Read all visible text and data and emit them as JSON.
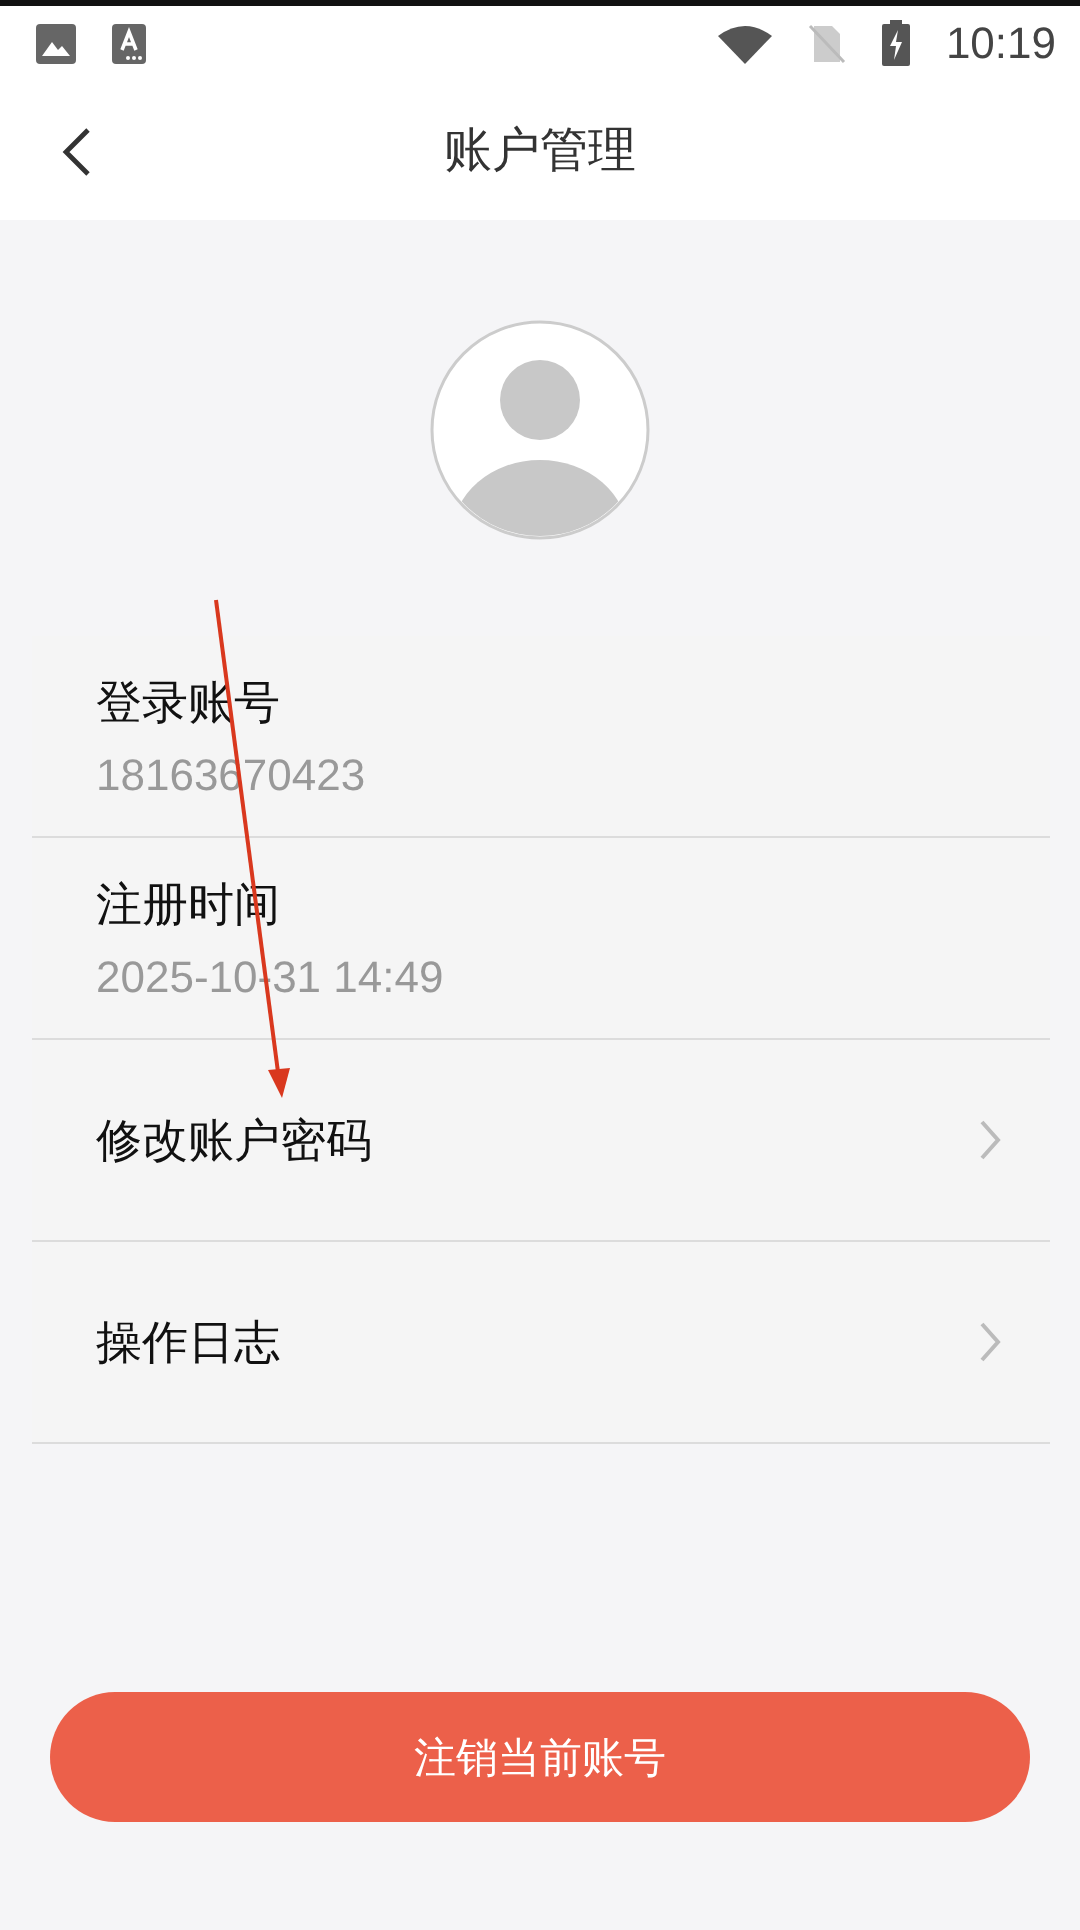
{
  "status_bar": {
    "time": "10:19"
  },
  "header": {
    "title": "账户管理"
  },
  "account_rows": [
    {
      "kind": "info",
      "label": "登录账号",
      "value": "18163670423"
    },
    {
      "kind": "info",
      "label": "注册时间",
      "value": "2025-10-31 14:49"
    },
    {
      "kind": "link",
      "label": "修改账户密码"
    },
    {
      "kind": "link",
      "label": "操作日志"
    }
  ],
  "logout_button": {
    "label": "注销当前账号"
  }
}
